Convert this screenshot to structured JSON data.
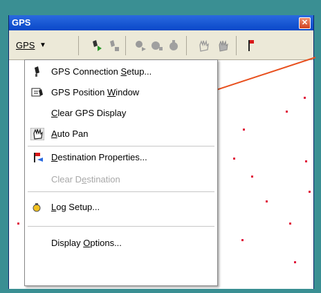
{
  "window": {
    "title": "GPS",
    "close_glyph": "✕"
  },
  "toolbar": {
    "dropdown_label": "GPS",
    "dropdown_arrow": "▼",
    "icons": [
      "gps-connect-icon",
      "gps-disconnect-icon",
      "gps-pause-icon",
      "gps-record-icon",
      "gps-log-icon",
      "pan-hand-icon",
      "pan-auto-icon",
      "destination-flag-icon"
    ]
  },
  "menu": {
    "items": [
      {
        "pre": "GPS Connection ",
        "ul": "S",
        "post": "etup...",
        "icon": "gps-device-icon",
        "enabled": true
      },
      {
        "pre": "GPS Position ",
        "ul": "W",
        "post": "indow",
        "icon": "gps-position-window-icon",
        "enabled": true
      },
      {
        "pre": "",
        "ul": "C",
        "post": "lear GPS Display",
        "icon": "",
        "enabled": true
      },
      {
        "pre": "",
        "ul": "A",
        "post": "uto Pan",
        "icon": "auto-pan-icon",
        "enabled": true
      },
      {
        "pre": "",
        "ul": "D",
        "post": "estination Properties...",
        "icon": "destination-flag-icon",
        "enabled": true
      },
      {
        "pre": "Clear D",
        "ul": "e",
        "post": "stination",
        "icon": "",
        "enabled": false
      },
      {
        "pre": "",
        "ul": "L",
        "post": "og Setup...",
        "icon": "log-setup-icon",
        "enabled": true
      },
      {
        "pre": "Display ",
        "ul": "O",
        "post": "ptions...",
        "icon": "",
        "enabled": true
      }
    ]
  },
  "colors": {
    "accent_line": "#e8501e",
    "title_bar": "#0a48c8",
    "background": "#3a8f93"
  }
}
